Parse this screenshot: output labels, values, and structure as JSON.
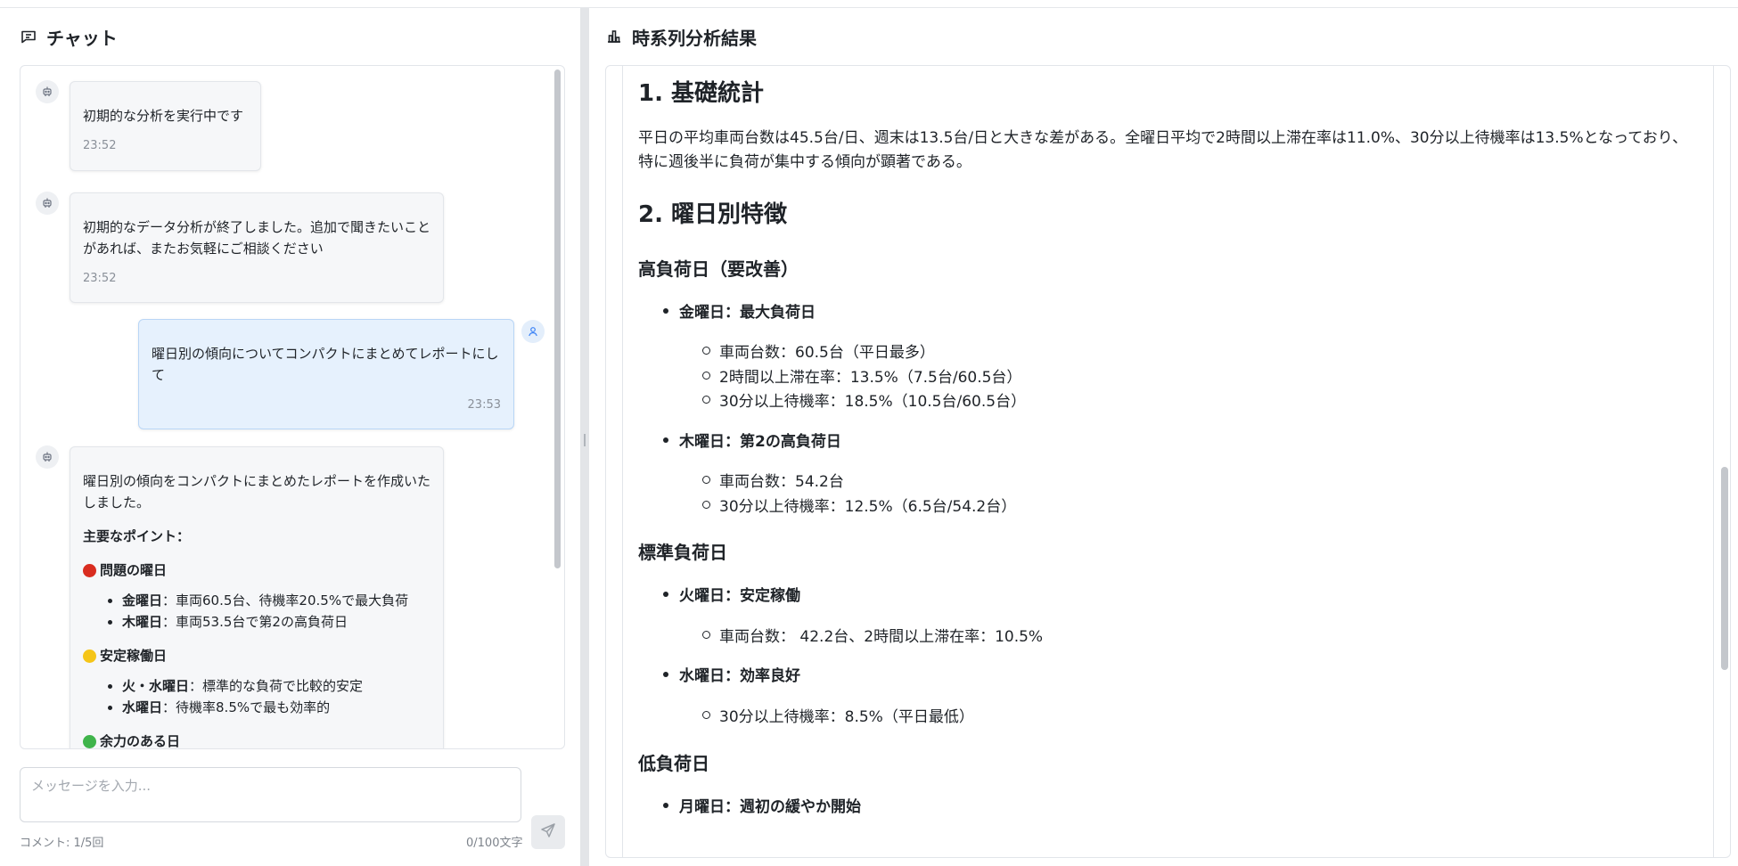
{
  "chat": {
    "title": "チャット",
    "messages": [
      {
        "text": "初期的な分析を実行中です",
        "time": "23:52"
      },
      {
        "text": "初期的なデータ分析が終了しました。追加で聞きたいことがあれば、またお気軽にご相談ください",
        "time": "23:52"
      },
      {
        "text": "曜日別の傾向についてコンパクトにまとめてレポートにして",
        "time": "23:53"
      },
      {
        "intro": "曜日別の傾向をコンパクトにまとめたレポートを作成いたしました。",
        "heading": "主要なポイント：",
        "sections": [
          {
            "title": "問題の曜日",
            "color": "#d92d20",
            "items": [
              {
                "label": "金曜日",
                "text": "：車両60.5台、待機率20.5%で最大負荷"
              },
              {
                "label": "木曜日",
                "text": "：車両53.5台で第2の高負荷日"
              }
            ]
          },
          {
            "title": "安定稼働日",
            "color": "#f5c518",
            "items": [
              {
                "label": "火・水曜日",
                "text": "：標準的な負荷で比較的安定"
              },
              {
                "label": "水曜日",
                "text": "：待機率8.5%で最も効率的"
              }
            ]
          },
          {
            "title": "余力のある日",
            "color": "#3fb44b"
          }
        ]
      }
    ],
    "input_placeholder": "メッセージを入力...",
    "comment_count": "コメント: 1/5回",
    "char_count": "0/100文字"
  },
  "report": {
    "title": "時系列分析結果",
    "h1_basic": "1. 基礎統計",
    "basic_text": "平日の平均車両台数は45.5台/日、週末は13.5台/日と大きな差がある。全曜日平均で2時間以上滞在率は11.0%、30分以上待機率は13.5%となっており、特に週後半に負荷が集中する傾向が顕著である。",
    "h1_weekday": "2. 曜日別特徴",
    "high": {
      "heading": "高負荷日（要改善）",
      "friday": {
        "label": "金曜日：最大負荷日",
        "items": [
          "車両台数：60.5台（平日最多）",
          "2時間以上滞在率：13.5%（7.5台/60.5台）",
          "30分以上待機率：18.5%（10.5台/60.5台）"
        ]
      },
      "thursday": {
        "label": "木曜日：第2の高負荷日",
        "items": [
          "車両台数：54.2台",
          "30分以上待機率：12.5%（6.5台/54.2台）"
        ]
      }
    },
    "standard": {
      "heading": "標準負荷日",
      "tuesday": {
        "label": "火曜日：安定稼働",
        "items": [
          "車両台数： 42.2台、2時間以上滞在率：10.5%"
        ]
      },
      "wednesday": {
        "label": "水曜日：効率良好",
        "items": [
          "30分以上待機率：8.5%（平日最低）"
        ]
      }
    },
    "low": {
      "heading": "低負荷日",
      "monday": {
        "label": "月曜日：週初の緩やか開始"
      }
    }
  },
  "icons": {
    "chat": "message-square-icon",
    "chart": "bar-chart-icon",
    "bot": "robot-icon",
    "user": "user-icon",
    "send": "send-icon"
  }
}
